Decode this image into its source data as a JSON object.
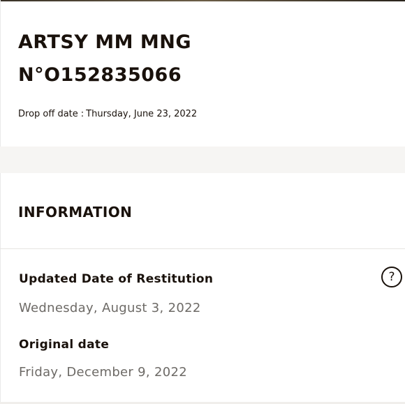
{
  "header": {
    "product_name": "ARTSY MM MNG",
    "order_number": "N°O152835066",
    "dropoff_label": "Drop off date",
    "dropoff_separator": ":",
    "dropoff_date": "Thursday, June 23, 2022"
  },
  "information": {
    "title": "INFORMATION",
    "updated_label": "Updated Date of Restitution",
    "updated_value": "Wednesday, August 3, 2022",
    "original_label": "Original date",
    "original_value": "Friday, December 9, 2022",
    "help_icon": "question-circle-icon",
    "help_glyph": "?"
  },
  "colors": {
    "text": "#19110b",
    "muted_text": "#6d6a66",
    "band": "#f6f5f3",
    "divider": "#e6e4e1"
  }
}
